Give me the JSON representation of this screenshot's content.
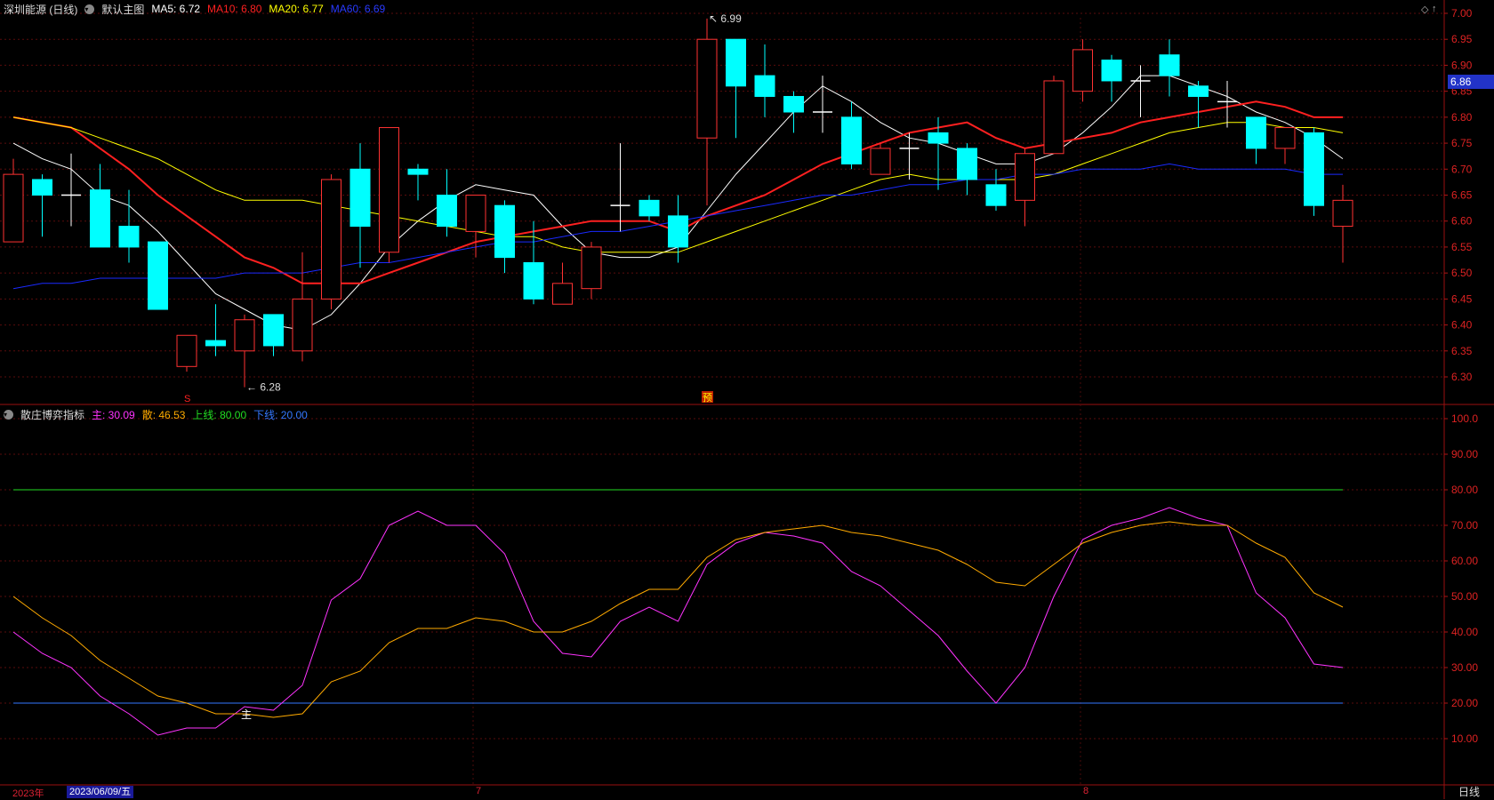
{
  "header": {
    "stock_name": "深圳能源 (日线)",
    "main_chart_label": "默认主图",
    "ma": [
      {
        "label": "MA5: 6.72",
        "color": "#ffffff"
      },
      {
        "label": "MA10: 6.80",
        "color": "#ff2020"
      },
      {
        "label": "MA20: 6.77",
        "color": "#ffff00"
      },
      {
        "label": "MA60: 6.69",
        "color": "#1a2aff"
      }
    ]
  },
  "indicator_header": {
    "name": "散庄博弈指标",
    "items": [
      {
        "label": "主: 30.09",
        "color": "#ff33ff"
      },
      {
        "label": "散: 46.53",
        "color": "#ffaa00"
      },
      {
        "label": "上线: 80.00",
        "color": "#22dd22"
      },
      {
        "label": "下线: 20.00",
        "color": "#3377ff"
      }
    ]
  },
  "price_axis": [
    "7.00",
    "6.95",
    "6.90",
    "6.85",
    "6.80",
    "6.75",
    "6.70",
    "6.65",
    "6.60",
    "6.55",
    "6.50",
    "6.45",
    "6.40",
    "6.35",
    "6.30"
  ],
  "current_price": "6.86",
  "indicator_axis": [
    "100.0",
    "90.00",
    "80.00",
    "70.00",
    "60.00",
    "50.00",
    "40.00",
    "30.00",
    "20.00",
    "10.00"
  ],
  "annotations": {
    "high": "6.99",
    "low": "6.28",
    "marker_s": "S",
    "marker_yu": "预",
    "marker_zhu": "主"
  },
  "bottom": {
    "year": "2023年",
    "date": "2023/06/09/五",
    "month7": "7",
    "month8": "8",
    "mode": "日线"
  },
  "chart_data": [
    {
      "type": "candlestick",
      "title": "深圳能源 (日线)",
      "ylim": [
        6.25,
        7.02
      ],
      "candles": [
        {
          "o": 6.56,
          "c": 6.69,
          "h": 6.72,
          "l": 6.56,
          "up": true
        },
        {
          "o": 6.68,
          "c": 6.65,
          "h": 6.69,
          "l": 6.57,
          "up": false
        },
        {
          "o": 6.65,
          "c": 6.65,
          "h": 6.73,
          "l": 6.59,
          "up": false,
          "doji": true
        },
        {
          "o": 6.66,
          "c": 6.55,
          "h": 6.71,
          "l": 6.55,
          "up": false
        },
        {
          "o": 6.59,
          "c": 6.55,
          "h": 6.66,
          "l": 6.52,
          "up": false
        },
        {
          "o": 6.56,
          "c": 6.43,
          "h": 6.56,
          "l": 6.43,
          "up": false
        },
        {
          "o": 6.32,
          "c": 6.38,
          "h": 6.38,
          "l": 6.31,
          "up": true
        },
        {
          "o": 6.37,
          "c": 6.36,
          "h": 6.44,
          "l": 6.34,
          "up": false
        },
        {
          "o": 6.35,
          "c": 6.41,
          "h": 6.42,
          "l": 6.28,
          "up": true
        },
        {
          "o": 6.42,
          "c": 6.36,
          "h": 6.42,
          "l": 6.34,
          "up": false
        },
        {
          "o": 6.35,
          "c": 6.45,
          "h": 6.54,
          "l": 6.33,
          "up": true
        },
        {
          "o": 6.45,
          "c": 6.68,
          "h": 6.69,
          "l": 6.43,
          "up": true
        },
        {
          "o": 6.7,
          "c": 6.59,
          "h": 6.75,
          "l": 6.51,
          "up": false
        },
        {
          "o": 6.54,
          "c": 6.78,
          "h": 6.78,
          "l": 6.52,
          "up": true
        },
        {
          "o": 6.7,
          "c": 6.69,
          "h": 6.71,
          "l": 6.64,
          "up": false
        },
        {
          "o": 6.65,
          "c": 6.59,
          "h": 6.7,
          "l": 6.57,
          "up": false
        },
        {
          "o": 6.58,
          "c": 6.65,
          "h": 6.65,
          "l": 6.53,
          "up": true
        },
        {
          "o": 6.63,
          "c": 6.53,
          "h": 6.64,
          "l": 6.5,
          "up": false
        },
        {
          "o": 6.52,
          "c": 6.45,
          "h": 6.6,
          "l": 6.44,
          "up": false
        },
        {
          "o": 6.44,
          "c": 6.48,
          "h": 6.52,
          "l": 6.44,
          "up": true
        },
        {
          "o": 6.47,
          "c": 6.55,
          "h": 6.56,
          "l": 6.45,
          "up": true
        },
        {
          "o": 6.63,
          "c": 6.63,
          "h": 6.75,
          "l": 6.58,
          "up": false,
          "doji": true
        },
        {
          "o": 6.64,
          "c": 6.61,
          "h": 6.65,
          "l": 6.6,
          "up": false
        },
        {
          "o": 6.61,
          "c": 6.55,
          "h": 6.65,
          "l": 6.52,
          "up": false
        },
        {
          "o": 6.76,
          "c": 6.95,
          "h": 6.99,
          "l": 6.63,
          "up": true
        },
        {
          "o": 6.95,
          "c": 6.86,
          "h": 6.95,
          "l": 6.76,
          "up": false
        },
        {
          "o": 6.88,
          "c": 6.84,
          "h": 6.94,
          "l": 6.8,
          "up": false
        },
        {
          "o": 6.84,
          "c": 6.81,
          "h": 6.85,
          "l": 6.77,
          "up": false
        },
        {
          "o": 6.81,
          "c": 6.81,
          "h": 6.88,
          "l": 6.77,
          "up": false,
          "doji": true
        },
        {
          "o": 6.8,
          "c": 6.71,
          "h": 6.83,
          "l": 6.7,
          "up": false
        },
        {
          "o": 6.69,
          "c": 6.74,
          "h": 6.75,
          "l": 6.69,
          "up": true
        },
        {
          "o": 6.74,
          "c": 6.74,
          "h": 6.77,
          "l": 6.68,
          "up": false,
          "doji": true
        },
        {
          "o": 6.77,
          "c": 6.75,
          "h": 6.8,
          "l": 6.66,
          "up": false
        },
        {
          "o": 6.74,
          "c": 6.68,
          "h": 6.75,
          "l": 6.65,
          "up": false
        },
        {
          "o": 6.67,
          "c": 6.63,
          "h": 6.7,
          "l": 6.62,
          "up": false
        },
        {
          "o": 6.64,
          "c": 6.73,
          "h": 6.74,
          "l": 6.59,
          "up": true
        },
        {
          "o": 6.73,
          "c": 6.87,
          "h": 6.88,
          "l": 6.73,
          "up": true
        },
        {
          "o": 6.85,
          "c": 6.93,
          "h": 6.95,
          "l": 6.83,
          "up": true
        },
        {
          "o": 6.91,
          "c": 6.87,
          "h": 6.92,
          "l": 6.83,
          "up": false
        },
        {
          "o": 6.87,
          "c": 6.87,
          "h": 6.9,
          "l": 6.8,
          "up": false,
          "doji": true
        },
        {
          "o": 6.92,
          "c": 6.88,
          "h": 6.95,
          "l": 6.84,
          "up": false
        },
        {
          "o": 6.86,
          "c": 6.84,
          "h": 6.87,
          "l": 6.78,
          "up": false
        },
        {
          "o": 6.83,
          "c": 6.83,
          "h": 6.87,
          "l": 6.78,
          "up": false,
          "doji": true
        },
        {
          "o": 6.8,
          "c": 6.74,
          "h": 6.8,
          "l": 6.71,
          "up": false
        },
        {
          "o": 6.74,
          "c": 6.78,
          "h": 6.78,
          "l": 6.71,
          "up": true
        },
        {
          "o": 6.77,
          "c": 6.63,
          "h": 6.78,
          "l": 6.61,
          "up": false
        },
        {
          "o": 6.59,
          "c": 6.64,
          "h": 6.67,
          "l": 6.52,
          "up": true
        }
      ],
      "series": [
        {
          "name": "MA5",
          "color": "#ffffff",
          "width": 1,
          "values": [
            6.75,
            6.72,
            6.7,
            6.65,
            6.63,
            6.58,
            6.52,
            6.46,
            6.43,
            6.4,
            6.39,
            6.42,
            6.48,
            6.55,
            6.6,
            6.64,
            6.67,
            6.66,
            6.65,
            6.59,
            6.54,
            6.53,
            6.53,
            6.55,
            6.62,
            6.69,
            6.75,
            6.81,
            6.86,
            6.83,
            6.79,
            6.76,
            6.75,
            6.73,
            6.71,
            6.71,
            6.73,
            6.77,
            6.82,
            6.88,
            6.88,
            6.86,
            6.84,
            6.81,
            6.79,
            6.76,
            6.72
          ]
        },
        {
          "name": "MA10",
          "color": "#ff2020",
          "width": 2,
          "values": [
            6.8,
            6.79,
            6.78,
            6.74,
            6.7,
            6.65,
            6.61,
            6.57,
            6.53,
            6.51,
            6.48,
            6.48,
            6.48,
            6.5,
            6.52,
            6.54,
            6.56,
            6.57,
            6.58,
            6.59,
            6.6,
            6.6,
            6.6,
            6.58,
            6.61,
            6.63,
            6.65,
            6.68,
            6.71,
            6.73,
            6.75,
            6.77,
            6.78,
            6.79,
            6.76,
            6.74,
            6.75,
            6.76,
            6.77,
            6.79,
            6.8,
            6.81,
            6.82,
            6.83,
            6.82,
            6.8,
            6.8
          ]
        },
        {
          "name": "MA20",
          "color": "#ffff00",
          "width": 1,
          "values": [
            6.8,
            6.79,
            6.78,
            6.76,
            6.74,
            6.72,
            6.69,
            6.66,
            6.64,
            6.64,
            6.64,
            6.63,
            6.62,
            6.61,
            6.6,
            6.59,
            6.58,
            6.57,
            6.57,
            6.55,
            6.54,
            6.54,
            6.54,
            6.54,
            6.56,
            6.58,
            6.6,
            6.62,
            6.64,
            6.66,
            6.68,
            6.69,
            6.68,
            6.68,
            6.68,
            6.68,
            6.69,
            6.71,
            6.73,
            6.75,
            6.77,
            6.78,
            6.79,
            6.79,
            6.78,
            6.78,
            6.77
          ]
        },
        {
          "name": "MA60",
          "color": "#1a2aff",
          "width": 1,
          "values": [
            6.47,
            6.48,
            6.48,
            6.49,
            6.49,
            6.49,
            6.49,
            6.49,
            6.5,
            6.5,
            6.5,
            6.51,
            6.52,
            6.52,
            6.53,
            6.54,
            6.55,
            6.56,
            6.56,
            6.57,
            6.58,
            6.58,
            6.59,
            6.6,
            6.61,
            6.62,
            6.63,
            6.64,
            6.65,
            6.65,
            6.66,
            6.67,
            6.67,
            6.68,
            6.68,
            6.69,
            6.69,
            6.7,
            6.7,
            6.7,
            6.71,
            6.7,
            6.7,
            6.7,
            6.7,
            6.69,
            6.69
          ]
        }
      ]
    },
    {
      "type": "line",
      "title": "散庄博弈指标",
      "ylim": [
        0,
        105
      ],
      "ticks": [
        100,
        90,
        80,
        70,
        60,
        50,
        40,
        30,
        20,
        10
      ],
      "hlines": [
        {
          "name": "上线",
          "value": 80,
          "color": "#22dd22"
        },
        {
          "name": "下线",
          "value": 20,
          "color": "#3377ff"
        }
      ],
      "series": [
        {
          "name": "主",
          "color": "#ff33ff",
          "values": [
            40,
            34,
            30,
            22,
            17,
            11,
            13,
            13,
            19,
            18,
            25,
            49,
            55,
            70,
            74,
            70,
            70,
            62,
            43,
            34,
            33,
            43,
            47,
            43,
            59,
            65,
            68,
            67,
            65,
            57,
            53,
            46,
            39,
            29,
            20,
            30,
            50,
            66,
            70,
            72,
            75,
            72,
            70,
            51,
            44,
            31,
            30
          ]
        },
        {
          "name": "散",
          "color": "#ffaa00",
          "values": [
            50,
            44,
            39,
            32,
            27,
            22,
            20,
            17,
            17,
            16,
            17,
            26,
            29,
            37,
            41,
            41,
            44,
            43,
            40,
            40,
            43,
            48,
            52,
            52,
            61,
            66,
            68,
            69,
            70,
            68,
            67,
            65,
            63,
            59,
            54,
            53,
            59,
            65,
            68,
            70,
            71,
            70,
            70,
            65,
            61,
            51,
            47
          ]
        }
      ]
    }
  ]
}
